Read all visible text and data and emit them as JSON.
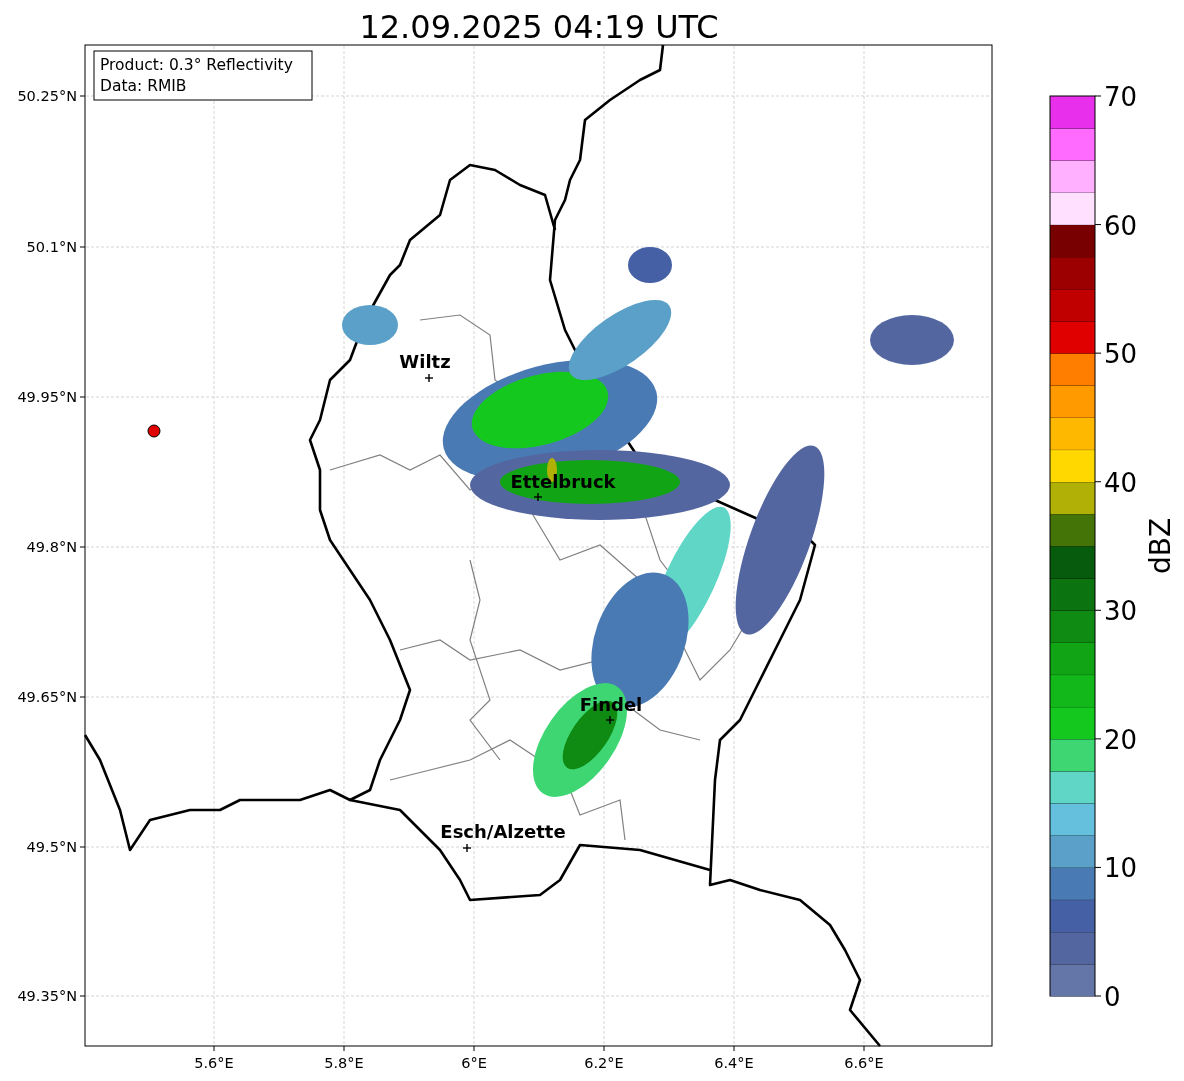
{
  "title": "12.09.2025 04:19 UTC",
  "info_box": {
    "lines": [
      "Product: 0.3° Reflectivity",
      "Data: RMIB"
    ]
  },
  "map": {
    "latitude_ticks": [
      "50.25°N",
      "50.1°N",
      "49.95°N",
      "49.8°N",
      "49.65°N",
      "49.5°N",
      "49.35°N"
    ],
    "longitude_ticks": [
      "5.6°E",
      "5.8°E",
      "6°E",
      "6.2°E",
      "6.4°E",
      "6.6°E"
    ],
    "places": [
      {
        "label": "Wiltz"
      },
      {
        "label": "Ettelbruck"
      },
      {
        "label": "Findel"
      },
      {
        "label": "Esch/Alzette"
      }
    ]
  },
  "colorbar": {
    "label": "dBZ",
    "ticks": [
      "70",
      "60",
      "50",
      "40",
      "30",
      "20",
      "10",
      "0"
    ]
  }
}
